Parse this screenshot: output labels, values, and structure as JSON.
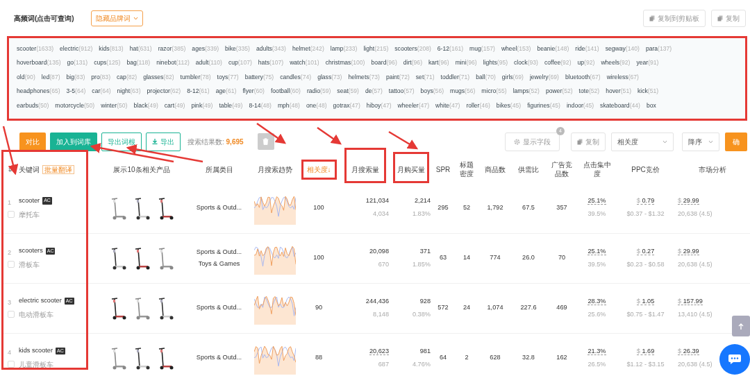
{
  "header": {
    "title": "高频词(点击可查询)",
    "filter_dropdown": "隐藏品牌词",
    "buttons": [
      "复制到剪贴板",
      "复制"
    ]
  },
  "keyword_rows": [
    {
      "chips": [
        {
          "word": "scooter",
          "count": "(1633)"
        },
        {
          "word": "electric",
          "count": "(912)"
        },
        {
          "word": "kids",
          "count": "(813)"
        },
        {
          "word": "hat",
          "count": "(631)"
        },
        {
          "word": "razor",
          "count": "(385)"
        },
        {
          "word": "ages",
          "count": "(339)"
        },
        {
          "word": "bike",
          "count": "(335)"
        },
        {
          "word": "adults",
          "count": "(343)"
        },
        {
          "word": "helmet",
          "count": "(242)"
        },
        {
          "word": "lamp",
          "count": "(233)"
        },
        {
          "word": "light",
          "count": "(215)"
        },
        {
          "word": "scooters",
          "count": "(208)"
        },
        {
          "word": "6-12",
          "count": "(161)"
        },
        {
          "word": "mug",
          "count": "(157)"
        },
        {
          "word": "wheel",
          "count": "(153)"
        },
        {
          "word": "beanie",
          "count": "(148)"
        },
        {
          "word": "ride",
          "count": "(141)"
        },
        {
          "word": "segway",
          "count": "(140)"
        },
        {
          "word": "para",
          "count": "(137)"
        }
      ]
    },
    {
      "chips": [
        {
          "word": "hoverboard",
          "count": "(135)"
        },
        {
          "word": "go",
          "count": "(131)"
        },
        {
          "word": "cups",
          "count": "(125)"
        },
        {
          "word": "bag",
          "count": "(118)"
        },
        {
          "word": "ninebot",
          "count": "(112)"
        },
        {
          "word": "adult",
          "count": "(110)"
        },
        {
          "word": "cup",
          "count": "(107)"
        },
        {
          "word": "hats",
          "count": "(107)"
        },
        {
          "word": "watch",
          "count": "(101)"
        },
        {
          "word": "christmas",
          "count": "(100)"
        },
        {
          "word": "board",
          "count": "(96)"
        },
        {
          "word": "dirt",
          "count": "(96)"
        },
        {
          "word": "kart",
          "count": "(96)"
        },
        {
          "word": "mini",
          "count": "(96)"
        },
        {
          "word": "lights",
          "count": "(95)"
        },
        {
          "word": "clock",
          "count": "(93)"
        },
        {
          "word": "coffee",
          "count": "(92)"
        },
        {
          "word": "up",
          "count": "(92)"
        },
        {
          "word": "wheels",
          "count": "(92)"
        },
        {
          "word": "year",
          "count": "(91)"
        }
      ]
    },
    {
      "chips": [
        {
          "word": "old",
          "count": "(90)"
        },
        {
          "word": "led",
          "count": "(87)"
        },
        {
          "word": "big",
          "count": "(83)"
        },
        {
          "word": "pro",
          "count": "(83)"
        },
        {
          "word": "cap",
          "count": "(82)"
        },
        {
          "word": "glasses",
          "count": "(82)"
        },
        {
          "word": "tumbler",
          "count": "(78)"
        },
        {
          "word": "toys",
          "count": "(77)"
        },
        {
          "word": "battery",
          "count": "(75)"
        },
        {
          "word": "candles",
          "count": "(74)"
        },
        {
          "word": "glass",
          "count": "(73)"
        },
        {
          "word": "helmets",
          "count": "(73)"
        },
        {
          "word": "paint",
          "count": "(72)"
        },
        {
          "word": "set",
          "count": "(71)"
        },
        {
          "word": "toddler",
          "count": "(71)"
        },
        {
          "word": "ball",
          "count": "(70)"
        },
        {
          "word": "girls",
          "count": "(69)"
        },
        {
          "word": "jewelry",
          "count": "(69)"
        },
        {
          "word": "bluetooth",
          "count": "(67)"
        },
        {
          "word": "wireless",
          "count": "(67)"
        }
      ]
    },
    {
      "chips": [
        {
          "word": "headphones",
          "count": "(65)"
        },
        {
          "word": "3-5",
          "count": "(64)"
        },
        {
          "word": "car",
          "count": "(64)"
        },
        {
          "word": "night",
          "count": "(63)"
        },
        {
          "word": "projector",
          "count": "(62)"
        },
        {
          "word": "8-12",
          "count": "(61)"
        },
        {
          "word": "age",
          "count": "(61)"
        },
        {
          "word": "flyer",
          "count": "(60)"
        },
        {
          "word": "football",
          "count": "(60)"
        },
        {
          "word": "radio",
          "count": "(59)"
        },
        {
          "word": "seat",
          "count": "(59)"
        },
        {
          "word": "de",
          "count": "(57)"
        },
        {
          "word": "tattoo",
          "count": "(57)"
        },
        {
          "word": "boys",
          "count": "(56)"
        },
        {
          "word": "mugs",
          "count": "(56)"
        },
        {
          "word": "micro",
          "count": "(55)"
        },
        {
          "word": "lamps",
          "count": "(52)"
        },
        {
          "word": "power",
          "count": "(52)"
        },
        {
          "word": "tote",
          "count": "(52)"
        },
        {
          "word": "hover",
          "count": "(51)"
        },
        {
          "word": "kick",
          "count": "(51)"
        }
      ]
    },
    {
      "chips": [
        {
          "word": "earbuds",
          "count": "(50)"
        },
        {
          "word": "motorcycle",
          "count": "(50)"
        },
        {
          "word": "winter",
          "count": "(50)"
        },
        {
          "word": "black",
          "count": "(49)"
        },
        {
          "word": "cart",
          "count": "(49)"
        },
        {
          "word": "pink",
          "count": "(49)"
        },
        {
          "word": "table",
          "count": "(49)"
        },
        {
          "word": "8-14",
          "count": "(48)"
        },
        {
          "word": "mph",
          "count": "(48)"
        },
        {
          "word": "one",
          "count": "(48)"
        },
        {
          "word": "gotrax",
          "count": "(47)"
        },
        {
          "word": "hiboy",
          "count": "(47)"
        },
        {
          "word": "wheeler",
          "count": "(47)"
        },
        {
          "word": "white",
          "count": "(47)"
        },
        {
          "word": "roller",
          "count": "(46)"
        },
        {
          "word": "bikes",
          "count": "(45)"
        },
        {
          "word": "figurines",
          "count": "(45)"
        },
        {
          "word": "indoor",
          "count": "(45)"
        },
        {
          "word": "skateboard",
          "count": "(44)"
        },
        {
          "word": "box"
        }
      ]
    }
  ],
  "toolbar": {
    "buttons": [
      {
        "label": "对比",
        "kind": "warning"
      },
      {
        "label": "加入到词库",
        "kind": "success"
      },
      {
        "label": "导出词根",
        "kind": "outline"
      },
      {
        "label": "导出",
        "kind": "download"
      }
    ],
    "result_label": "搜索结果数:",
    "result_count": "9,695",
    "columns_button": "显示字段",
    "columns_badge": "4",
    "copy_button": "复制",
    "sort_field": "相关度",
    "sort_order": "降序",
    "confirm_button": "确"
  },
  "table": {
    "columns": [
      {
        "label": "#",
        "sorted": false
      },
      {
        "label": "关键词",
        "link": "批量翻译",
        "sorted": false
      },
      {
        "label": "展示10条相关产品",
        "sorted": false
      },
      {
        "label": "所属类目",
        "sorted": false
      },
      {
        "label": "月搜索趋势",
        "sorted": false
      },
      {
        "label": "相关度↓",
        "sorted": true
      },
      {
        "label": "月搜索量",
        "sorted": false
      },
      {
        "label": "月购买量",
        "sorted": false
      },
      {
        "label": "SPR",
        "sorted": false
      },
      {
        "label": "标题密度",
        "sorted": false
      },
      {
        "label": "商品数",
        "sorted": false
      },
      {
        "label": "供需比",
        "sorted": false
      },
      {
        "label": "广告竞品数",
        "sorted": false
      },
      {
        "label": "点击集中度",
        "sorted": false
      },
      {
        "label": "PPC竞价",
        "sorted": false
      },
      {
        "label": "市场分析",
        "sorted": false
      }
    ],
    "rows": [
      {
        "index": "1",
        "checked": false,
        "keyword": "scooter",
        "badge": "AC",
        "translation": "摩托车",
        "products": [
          {
            "kind": "picture"
          },
          {
            "kind": "picture"
          },
          {
            "kind": "picture"
          }
        ],
        "categories": [
          "Sports & Outd..."
        ],
        "relevance": "100",
        "search_volume": "121,034",
        "search_daily": "4,034",
        "purchases": "2,214",
        "purchase_rate": "1.83%",
        "spr": "295",
        "title_density": "52",
        "product_count": "1,792",
        "supply_demand": "67.5",
        "ad_products": "357",
        "click_share": "25.1%",
        "click_share_2": "39.5%",
        "ppc_currency": "$",
        "ppc": "0.79",
        "ppc_range": "$0.37 - $1.32",
        "price_currency": "$",
        "price": "29.99",
        "reviews": "20,638 (4.5)"
      },
      {
        "index": "2",
        "checked": false,
        "keyword": "scooters",
        "badge": "AC",
        "translation": "滑板车",
        "products": [
          {
            "kind": "picture"
          },
          {
            "kind": "picture"
          },
          {
            "kind": "picture"
          }
        ],
        "categories": [
          "Sports & Outd...",
          "Toys & Games"
        ],
        "relevance": "100",
        "search_volume": "20,098",
        "search_daily": "670",
        "purchases": "371",
        "purchase_rate": "1.85%",
        "spr": "63",
        "title_density": "14",
        "product_count": "774",
        "supply_demand": "26.0",
        "ad_products": "70",
        "click_share": "25.1%",
        "click_share_2": "39.5%",
        "ppc_currency": "$",
        "ppc": "0.27",
        "ppc_range": "$0.23 - $0.58",
        "price_currency": "$",
        "price": "29.99",
        "reviews": "20,638 (4.5)"
      },
      {
        "index": "3",
        "checked": false,
        "keyword": "electric scooter",
        "badge": "AC",
        "translation": "电动滑板车",
        "products": [
          {
            "kind": "picture"
          },
          {
            "kind": "picture"
          },
          {
            "kind": "picture"
          }
        ],
        "categories": [
          "Sports & Outd..."
        ],
        "relevance": "90",
        "search_volume": "244,436",
        "search_daily": "8,148",
        "purchases": "928",
        "purchase_rate": "0.38%",
        "spr": "572",
        "title_density": "24",
        "product_count": "1,074",
        "supply_demand": "227.6",
        "ad_products": "469",
        "click_share": "28.3%",
        "click_share_2": "25.6%",
        "ppc_currency": "$",
        "ppc": "1.05",
        "ppc_range": "$0.75 - $1.47",
        "price_currency": "$",
        "price": "157.99",
        "reviews": "13,410 (4.5)"
      },
      {
        "index": "4",
        "checked": false,
        "keyword": "kids scooter",
        "badge": "AC",
        "translation": "儿童滑板车",
        "products": [
          {
            "kind": "picture"
          },
          {
            "kind": "picture"
          },
          {
            "kind": "picture"
          }
        ],
        "categories": [
          "Sports & Outd..."
        ],
        "relevance": "88",
        "search_volume": "20,623",
        "search_daily": "687",
        "purchases": "981",
        "purchase_rate": "4.76%",
        "spr": "64",
        "title_density": "2",
        "product_count": "628",
        "supply_demand": "32.8",
        "ad_products": "162",
        "click_share": "21.3%",
        "click_share_2": "26.5%",
        "ppc_currency": "$",
        "ppc": "1.69",
        "ppc_range": "$1.12 - $3.15",
        "price_currency": "$",
        "price": "26.39",
        "reviews": "20,638 (4.5)"
      }
    ]
  }
}
